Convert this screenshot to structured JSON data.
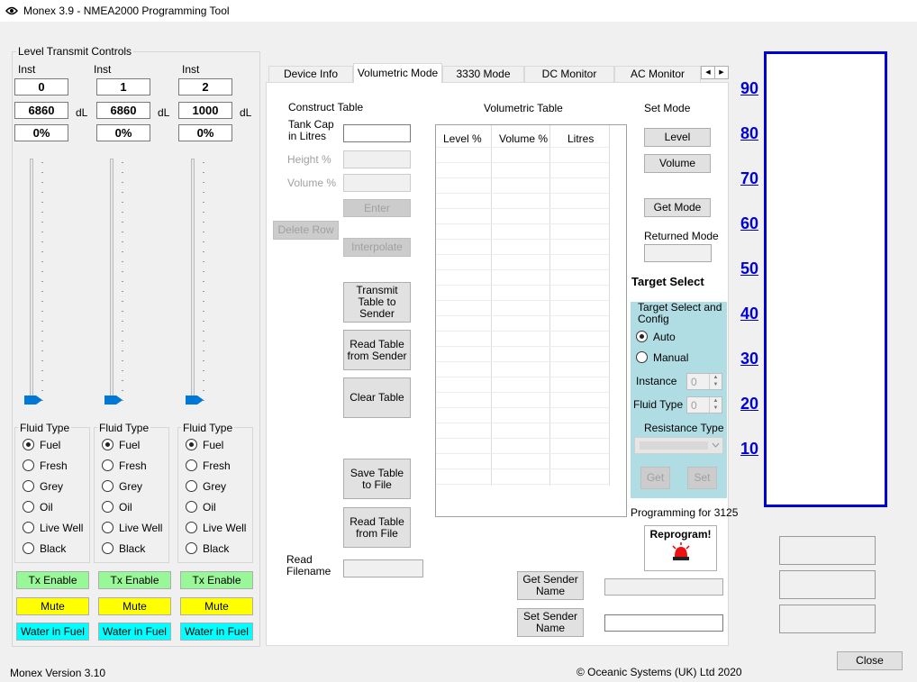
{
  "window": {
    "title": "Monex 3.9 - NMEA2000 Programming Tool"
  },
  "level_transmit": {
    "title": "Level Transmit Controls",
    "inst_label": "Inst",
    "unit_label": "dL",
    "fluid_type_label": "Fluid Type",
    "channels": [
      {
        "inst": "0",
        "value": "6860",
        "percent": "0%",
        "level": 0.0
      },
      {
        "inst": "1",
        "value": "6860",
        "percent": "0%",
        "level": 0.0
      },
      {
        "inst": "2",
        "value": "1000",
        "percent": "0%",
        "level": 0.0
      }
    ],
    "fluid_options": [
      "Fuel",
      "Fresh",
      "Grey",
      "Oil",
      "Live Well",
      "Black"
    ],
    "selected_fluid": "Fuel",
    "tx_enable_label": "Tx Enable",
    "mute_label": "Mute",
    "water_in_fuel_label": "Water in Fuel",
    "colors": {
      "tx_enable": "#98f898",
      "mute": "#ffff00",
      "water_in_fuel": "#00ffff"
    }
  },
  "tabs": [
    {
      "label": "Device Info",
      "active": false
    },
    {
      "label": "Volumetric Mode",
      "active": true
    },
    {
      "label": "3330 Mode",
      "active": false
    },
    {
      "label": "DC Monitor",
      "active": false
    },
    {
      "label": "AC Monitor",
      "active": false
    }
  ],
  "construct": {
    "title": "Construct Table",
    "tank_cap_label": "Tank Cap\nin Litres",
    "height_label": "Height %",
    "volume_label": "Volume %",
    "enter_label": "Enter",
    "delete_row_label": "Delete Row",
    "interpolate_label": "Interpolate",
    "transmit_label": "Transmit Table to Sender",
    "read_table_label": "Read Table from Sender",
    "clear_table_label": "Clear Table",
    "save_table_label": "Save Table to File",
    "read_file_label": "Read Table from File",
    "read_filename_label": "Read\nFilename"
  },
  "volumetric_table": {
    "title": "Volumetric Table",
    "columns": [
      "Level %",
      "Volume %",
      "Litres"
    ]
  },
  "set_mode": {
    "title": "Set Mode",
    "level_label": "Level",
    "volume_label": "Volume",
    "get_mode_label": "Get Mode",
    "returned_mode_label": "Returned Mode"
  },
  "target_select": {
    "title": "Target Select",
    "config_title": "Target Select and Config",
    "auto_label": "Auto",
    "manual_label": "Manual",
    "selected": "Auto",
    "instance_label": "Instance",
    "instance_value": "0",
    "fluid_type_label": "Fluid Type",
    "fluid_type_value": "0",
    "resistance_label": "Resistance Type",
    "get_label": "Get",
    "set_label": "Set",
    "panel_color": "#b0dde4"
  },
  "programming": {
    "label": "Programming for 3125",
    "reprogram_label": "Reprogram!"
  },
  "sender": {
    "get_label": "Get Sender Name",
    "set_label": "Set Sender Name"
  },
  "scale": {
    "labels": [
      "90",
      "80",
      "70",
      "60",
      "50",
      "40",
      "30",
      "20",
      "10"
    ],
    "color": "#0000d8"
  },
  "footer": {
    "version": "Monex Version 3.10",
    "copyright": "© Oceanic Systems (UK) Ltd 2020",
    "close_label": "Close"
  }
}
